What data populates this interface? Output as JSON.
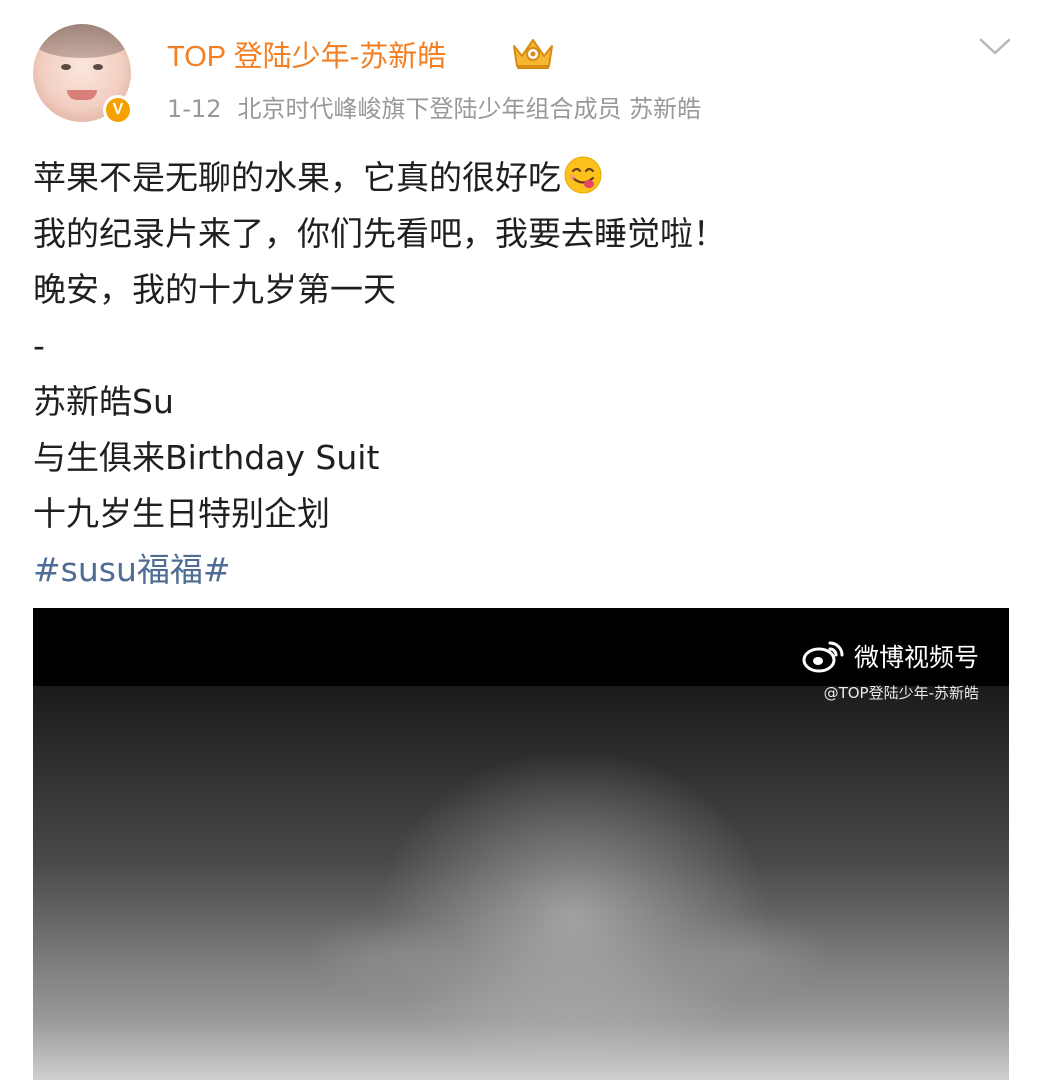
{
  "post": {
    "author": {
      "name": "TOP 登陆少年-苏新皓",
      "verified_badge": "V",
      "badge_icon": "crown-icon"
    },
    "meta": {
      "date": "1-12",
      "source": "北京时代峰峻旗下登陆少年组合成员 苏新皓"
    },
    "content": {
      "line1": "苹果不是无聊的水果，它真的很好吃",
      "line1_emoji": "yum-emoji-icon",
      "line2": "我的纪录片来了，你们先看吧，我要去睡觉啦！",
      "line3": "晚安，我的十九岁第一天",
      "separator": "-",
      "line4": "苏新皓Su",
      "line5": "与生俱来Birthday Suit",
      "line6": "十九岁生日特别企划",
      "hashtag": "#susu福福#"
    },
    "video": {
      "watermark_title": "微博视频号",
      "watermark_handle": "@TOP登陆少年-苏新皓"
    }
  },
  "colors": {
    "author_name": "#f37f22",
    "meta_text": "#999999",
    "hashtag": "#4e6c94",
    "verified_badge": "#f5a100"
  }
}
